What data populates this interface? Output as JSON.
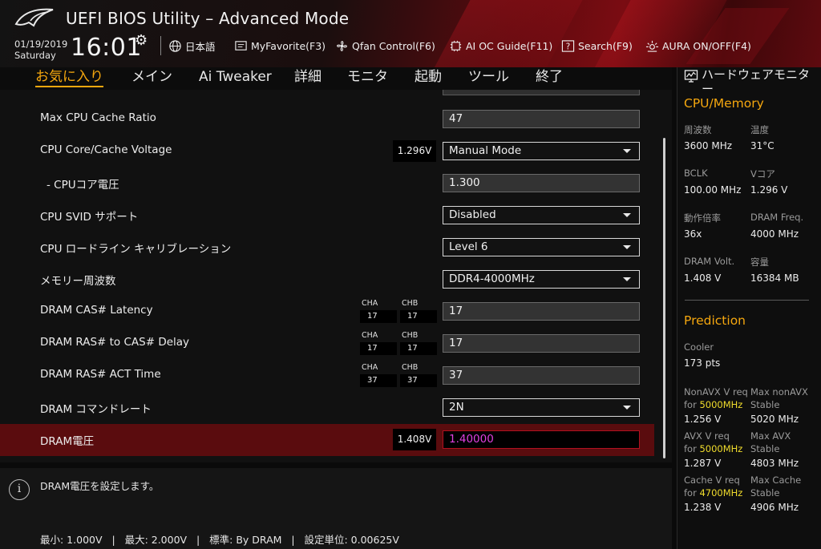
{
  "header": {
    "title": "UEFI BIOS Utility – Advanced Mode",
    "date": "01/19/2019",
    "day": "Saturday",
    "time": "16:01",
    "items": [
      {
        "label": "日本語",
        "icon": "globe-icon"
      },
      {
        "label": "MyFavorite(F3)",
        "icon": "favorite-icon"
      },
      {
        "label": "Qfan Control(F6)",
        "icon": "fan-icon"
      },
      {
        "label": "AI OC Guide(F11)",
        "icon": "ai-chip-icon"
      },
      {
        "label": "Search(F9)",
        "icon": "search-icon"
      },
      {
        "label": "AURA ON/OFF(F4)",
        "icon": "aura-icon"
      }
    ]
  },
  "tabs": [
    "お気に入り",
    "メイン",
    "Ai Tweaker",
    "詳細",
    "モニタ",
    "起動",
    "ツール",
    "終了"
  ],
  "active_tab": "お気に入り",
  "settings": [
    {
      "label": "Max CPU Cache Ratio",
      "value": "47",
      "type": "input"
    },
    {
      "label": "CPU Core/Cache Voltage",
      "value": "Manual Mode",
      "type": "dropdown",
      "badge": "1.296V"
    },
    {
      "label": "- CPUコア電圧",
      "value": "1.300",
      "type": "input"
    },
    {
      "label": "CPU SVID サポート",
      "value": "Disabled",
      "type": "dropdown"
    },
    {
      "label": "CPU ロードライン キャリブレーション",
      "value": "Level 6",
      "type": "dropdown"
    },
    {
      "label": "メモリー周波数",
      "value": "DDR4-4000MHz",
      "type": "dropdown"
    },
    {
      "label": "DRAM CAS# Latency",
      "value": "17",
      "type": "input",
      "cha": "17",
      "chb": "17"
    },
    {
      "label": "DRAM RAS# to CAS# Delay",
      "value": "17",
      "type": "input",
      "cha": "17",
      "chb": "17"
    },
    {
      "label": "DRAM RAS# ACT Time",
      "value": "37",
      "type": "input",
      "cha": "37",
      "chb": "37"
    },
    {
      "label": "DRAM コマンドレート",
      "value": "2N",
      "type": "dropdown"
    },
    {
      "label": "DRAM電圧",
      "value": "1.40000",
      "type": "input",
      "badge": "1.408V",
      "selected": true
    }
  ],
  "channel_labels": {
    "a": "CHA",
    "b": "CHB"
  },
  "help": {
    "text": "DRAM電圧を設定します。",
    "range": "最小: 1.000V   |   最大: 2.000V   |   標準: By DRAM   |   設定単位: 0.00625V"
  },
  "hw_monitor": {
    "title": "ハードウェアモニター",
    "cpu_section": "CPU/Memory",
    "cpu": [
      {
        "k": "周波数",
        "v": "3600 MHz"
      },
      {
        "k": "温度",
        "v": "31°C"
      },
      {
        "k": "BCLK",
        "v": "100.00 MHz"
      },
      {
        "k": "Vコア",
        "v": "1.296 V"
      },
      {
        "k": "動作倍率",
        "v": "36x"
      },
      {
        "k": "DRAM Freq.",
        "v": "4000 MHz"
      },
      {
        "k": "DRAM Volt.",
        "v": "1.408 V"
      },
      {
        "k": "容量",
        "v": "16384 MB"
      }
    ],
    "prediction_section": "Prediction",
    "cooler_label": "Cooler",
    "cooler_value": "173 pts",
    "pred": [
      {
        "k1": "NonAVX V req",
        "k2": "for ",
        "hl": "5000MHz",
        "v": "1.256 V"
      },
      {
        "k1": "Max nonAVX",
        "k2": "Stable",
        "hl": "",
        "v": "5020 MHz"
      },
      {
        "k1": "AVX V req",
        "k2": "for ",
        "hl": "5000MHz",
        "v": "1.287 V"
      },
      {
        "k1": "Max AVX",
        "k2": "Stable",
        "hl": "",
        "v": "4803 MHz"
      },
      {
        "k1": "Cache V req",
        "k2": "for ",
        "hl": "4700MHz",
        "v": "1.238 V"
      },
      {
        "k1": "Max Cache",
        "k2": "Stable",
        "hl": "",
        "v": "4906 MHz"
      }
    ]
  },
  "colors": {
    "accent": "#f5a70e",
    "selected_row": "#5a0c0e",
    "highlight": "#f0dc2c",
    "edit_text": "#e040e0"
  }
}
